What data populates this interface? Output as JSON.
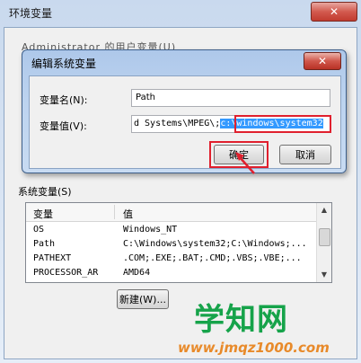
{
  "outer_window": {
    "title": "环境变量",
    "close_glyph": "✕",
    "partial_user_label": "Administrator 的用户变量(U)"
  },
  "system_vars": {
    "label": "系统变量(S)",
    "columns": [
      "变量",
      "值"
    ],
    "rows": [
      {
        "name": "OS",
        "value": "Windows_NT"
      },
      {
        "name": "Path",
        "value": "C:\\Windows\\system32;C:\\Windows;..."
      },
      {
        "name": "PATHEXT",
        "value": ".COM;.EXE;.BAT;.CMD;.VBS;.VBE;..."
      },
      {
        "name": "PROCESSOR_AR",
        "value": "AMD64"
      }
    ],
    "new_button": "新建(W)..."
  },
  "dialog": {
    "title": "编辑系统变量",
    "close_glyph": "✕",
    "name_label": "变量名(N):",
    "name_value": "Path",
    "value_label": "变量值(V):",
    "value_prefix": "d Systems\\MPEG\\;",
    "value_selected": "c:\\windows\\system32",
    "ok_button": "确定",
    "cancel_button": "取消"
  },
  "watermark": {
    "site_name": "学知网",
    "url": "www.jmqz1000.com"
  },
  "colors": {
    "highlight_red": "#e0202e",
    "selection_blue": "#3399ff",
    "watermark_green": "#16a34a",
    "watermark_orange": "#e88a2a"
  }
}
